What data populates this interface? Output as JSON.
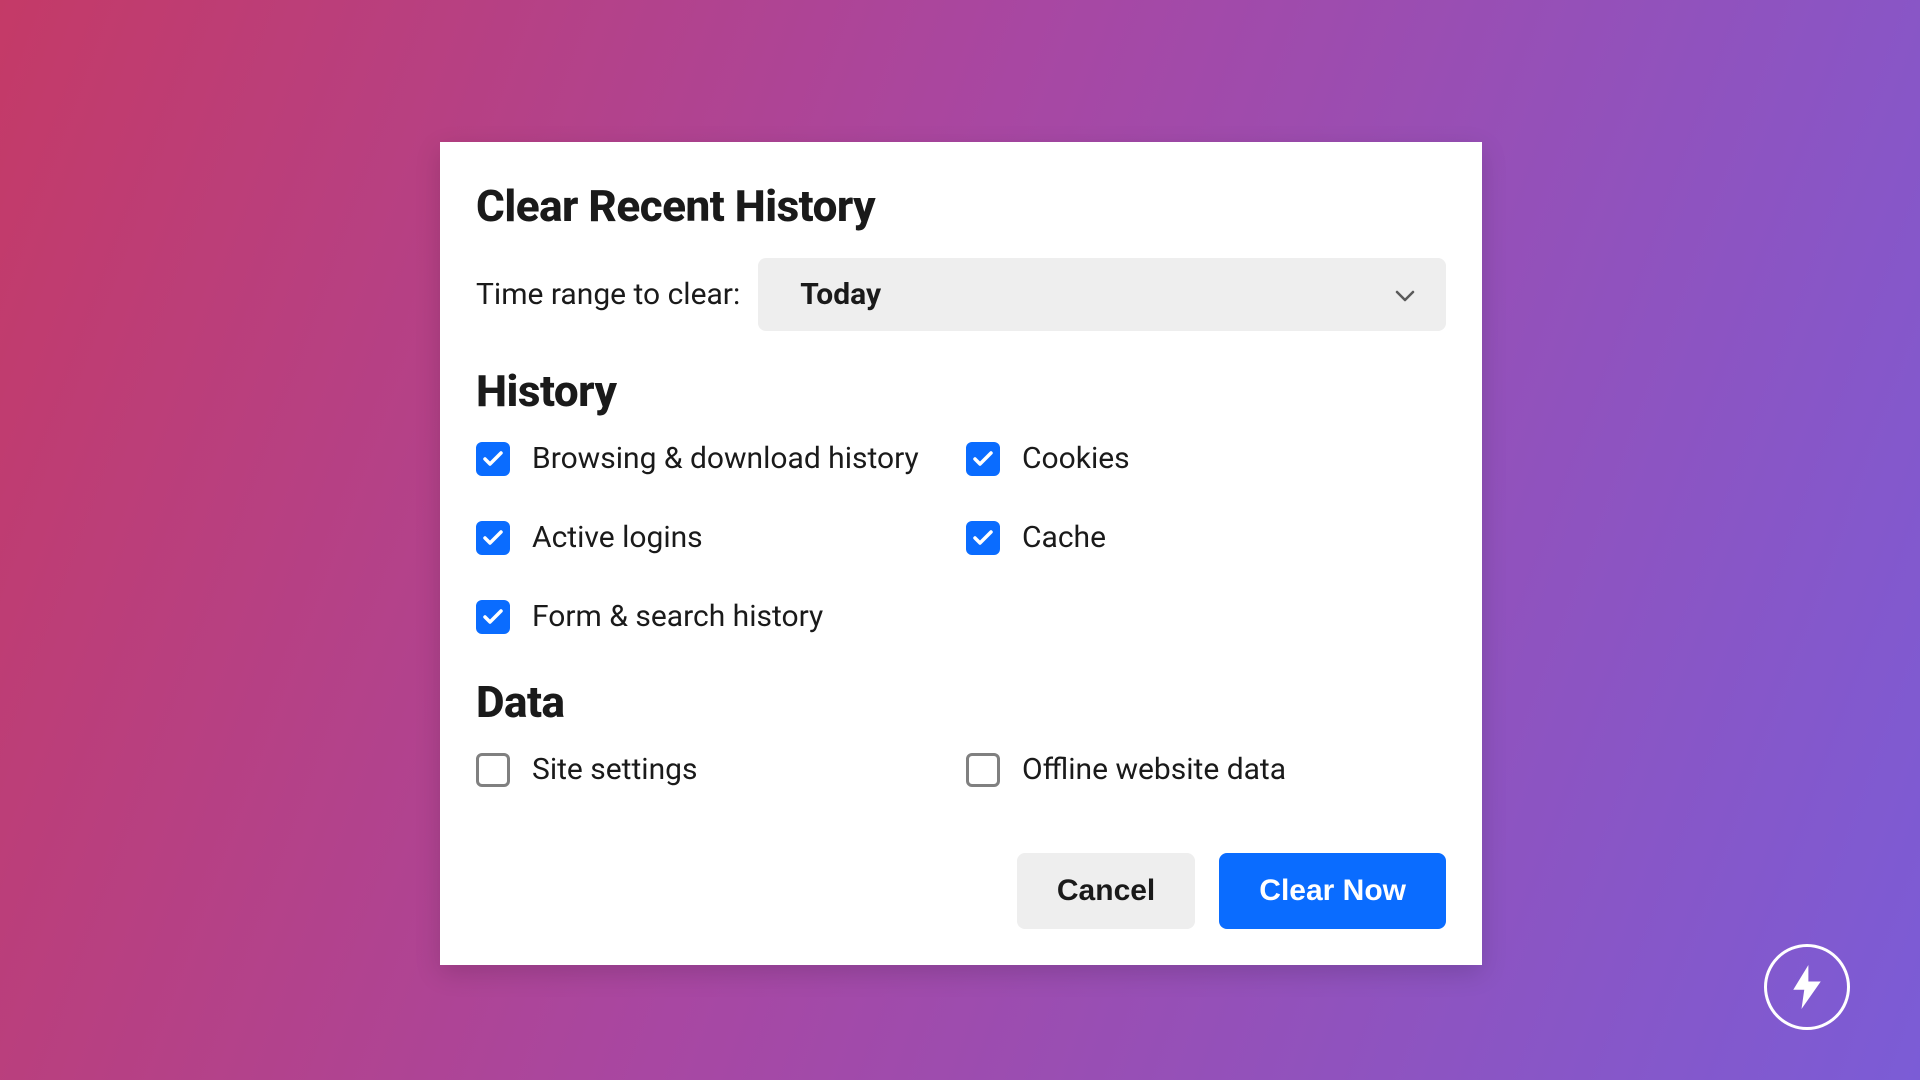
{
  "dialog": {
    "title": "Clear Recent History",
    "time_range": {
      "label": "Time range to clear:",
      "selected": "Today"
    },
    "sections": {
      "history": {
        "heading": "History",
        "items": [
          {
            "label": "Browsing & download history",
            "checked": true
          },
          {
            "label": "Cookies",
            "checked": true
          },
          {
            "label": "Active logins",
            "checked": true
          },
          {
            "label": "Cache",
            "checked": true
          },
          {
            "label": "Form & search history",
            "checked": true
          }
        ]
      },
      "data": {
        "heading": "Data",
        "items": [
          {
            "label": "Site settings",
            "checked": false
          },
          {
            "label": "Offline website data",
            "checked": false
          }
        ]
      }
    },
    "buttons": {
      "cancel": "Cancel",
      "confirm": "Clear Now"
    }
  },
  "colors": {
    "primary": "#0a6cff",
    "text": "#1a1a1a",
    "neutral_bg": "#eeeeee"
  }
}
